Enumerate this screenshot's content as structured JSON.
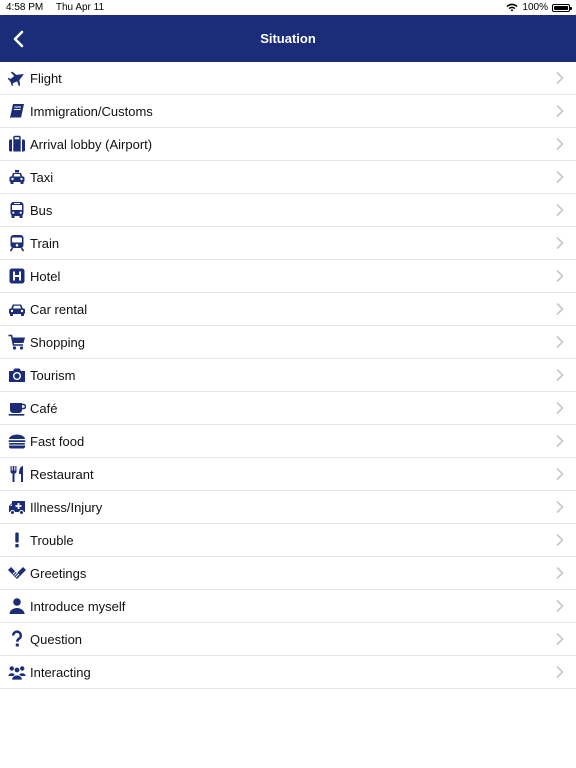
{
  "status": {
    "time": "4:58 PM",
    "date": "Thu Apr 11",
    "battery": "100%"
  },
  "header": {
    "title": "Situation",
    "back_icon": "chevron-left-icon"
  },
  "colors": {
    "nav_bg": "#1b2d78",
    "icon": "#1b2d78",
    "divider": "#e6e6e6",
    "chevron": "#c7c7cc"
  },
  "items": [
    {
      "label": "Flight",
      "icon": "airplane-icon"
    },
    {
      "label": "Immigration/Customs",
      "icon": "book-icon"
    },
    {
      "label": "Arrival lobby (Airport)",
      "icon": "suitcase-icon"
    },
    {
      "label": "Taxi",
      "icon": "taxi-icon"
    },
    {
      "label": "Bus",
      "icon": "bus-icon"
    },
    {
      "label": "Train",
      "icon": "train-icon"
    },
    {
      "label": "Hotel",
      "icon": "hotel-icon"
    },
    {
      "label": "Car rental",
      "icon": "car-icon"
    },
    {
      "label": "Shopping",
      "icon": "cart-icon"
    },
    {
      "label": "Tourism",
      "icon": "camera-icon"
    },
    {
      "label": "Café",
      "icon": "coffee-cup-icon"
    },
    {
      "label": "Fast food",
      "icon": "burger-icon"
    },
    {
      "label": "Restaurant",
      "icon": "fork-knife-icon"
    },
    {
      "label": "Illness/Injury",
      "icon": "ambulance-icon"
    },
    {
      "label": "Trouble",
      "icon": "exclamation-icon"
    },
    {
      "label": "Greetings",
      "icon": "handshake-icon"
    },
    {
      "label": "Introduce myself",
      "icon": "user-icon"
    },
    {
      "label": "Question",
      "icon": "question-icon"
    },
    {
      "label": "Interacting",
      "icon": "group-icon"
    }
  ]
}
